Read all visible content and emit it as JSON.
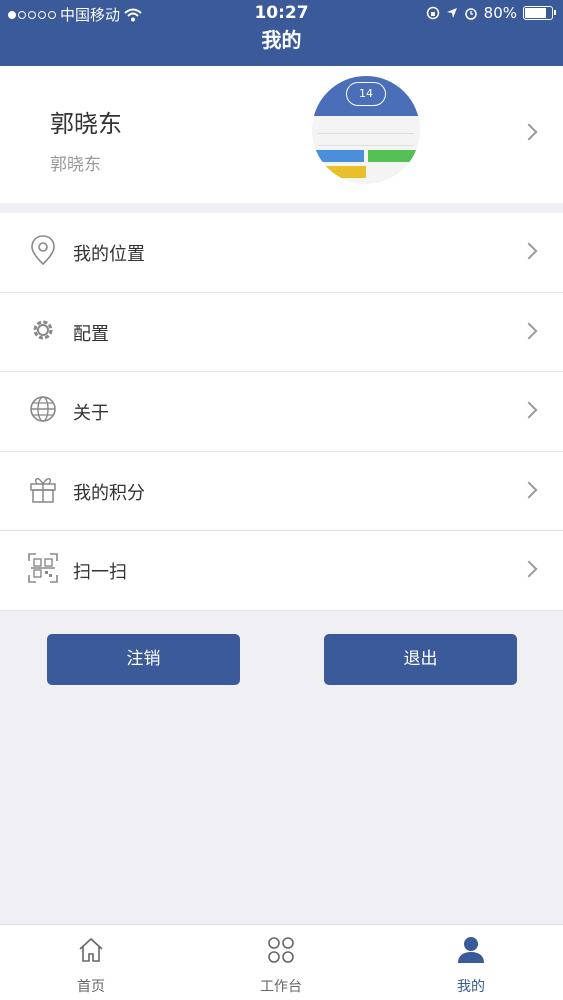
{
  "status_bar": {
    "carrier": "中国移动",
    "time": "10:27",
    "battery": "80%",
    "battery_level": 0.8
  },
  "nav": {
    "title": "我的"
  },
  "profile": {
    "name": "郭晓东",
    "subtitle": "郭晓东",
    "avatar_badge": "14"
  },
  "menu": [
    {
      "label": "我的位置",
      "icon": "location-pin-icon"
    },
    {
      "label": "配置",
      "icon": "gear-icon"
    },
    {
      "label": "关于",
      "icon": "globe-icon"
    },
    {
      "label": "我的积分",
      "icon": "gift-icon"
    },
    {
      "label": "扫一扫",
      "icon": "qr-scan-icon"
    }
  ],
  "buttons": {
    "cancel_account": "注销",
    "logout": "退出"
  },
  "tabbar": [
    {
      "label": "首页",
      "icon": "home-icon",
      "active": false
    },
    {
      "label": "工作台",
      "icon": "grid-dots-icon",
      "active": false
    },
    {
      "label": "我的",
      "icon": "user-icon",
      "active": true
    }
  ],
  "colors": {
    "primary": "#3b5a9a",
    "background": "#efeff4"
  }
}
